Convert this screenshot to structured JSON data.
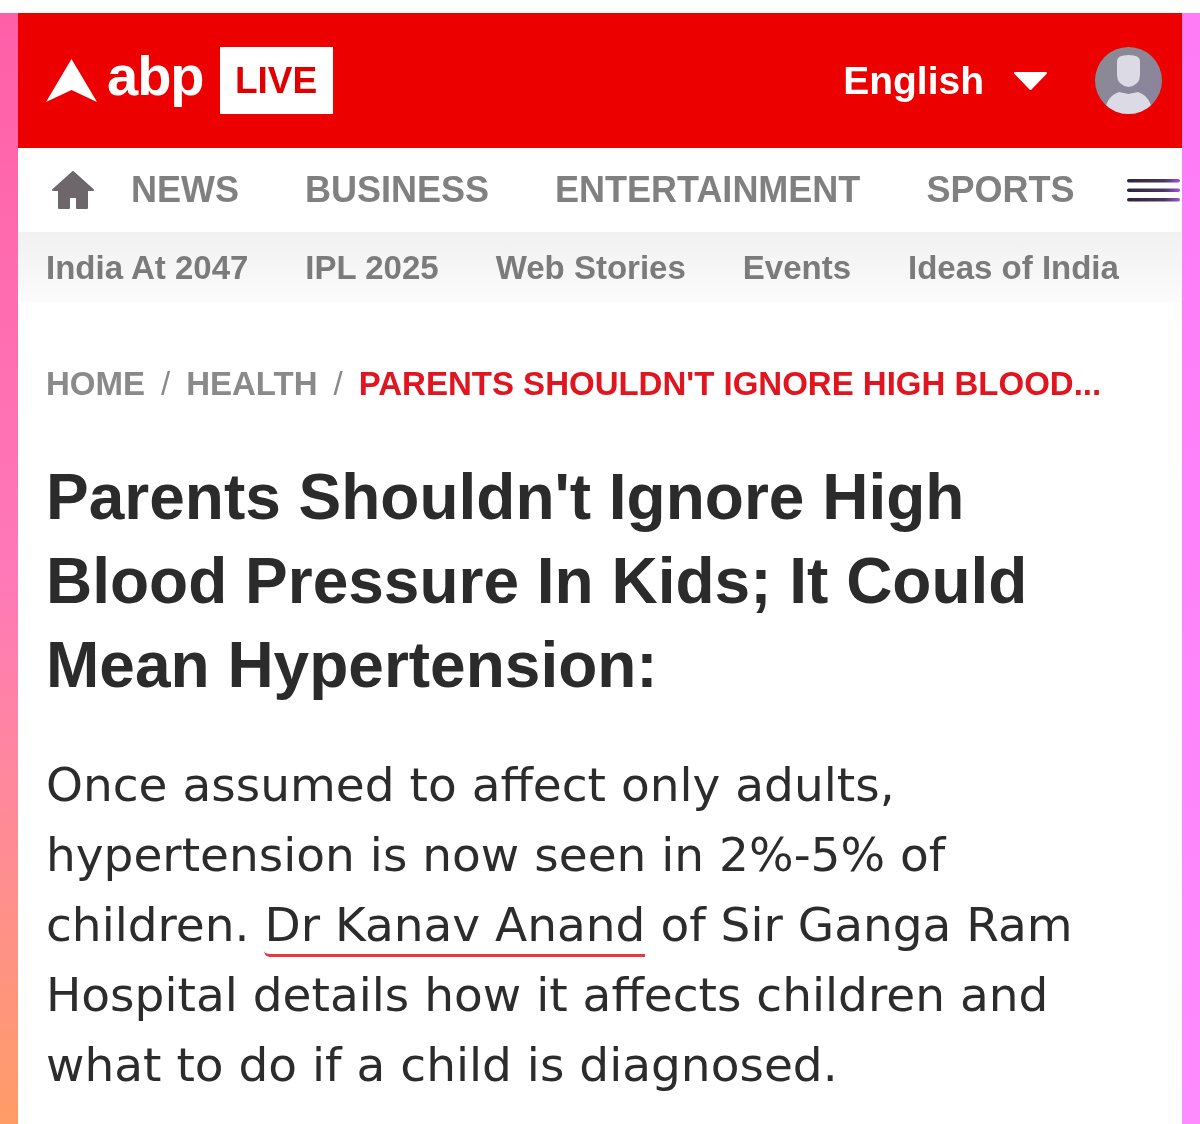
{
  "header": {
    "logo": {
      "wordmark": "abp",
      "badge": "LIVE"
    },
    "language": {
      "label": "English"
    }
  },
  "nav": {
    "items": [
      {
        "label": "NEWS"
      },
      {
        "label": "BUSINESS"
      },
      {
        "label": "ENTERTAINMENT"
      },
      {
        "label": "SPORTS"
      }
    ]
  },
  "sub_nav": {
    "items": [
      {
        "label": "India At 2047"
      },
      {
        "label": "IPL 2025"
      },
      {
        "label": "Web Stories"
      },
      {
        "label": "Events"
      },
      {
        "label": "Ideas of India"
      }
    ]
  },
  "breadcrumb": [
    {
      "kind": "link",
      "label": "HOME"
    },
    {
      "kind": "separator",
      "label": "/"
    },
    {
      "kind": "link",
      "label": "HEALTH"
    },
    {
      "kind": "separator",
      "label": "/"
    },
    {
      "kind": "current",
      "label": "PARENTS SHOULDN'T IGNORE HIGH BLOOD..."
    }
  ],
  "article": {
    "title": "Parents Shouldn't Ignore High Blood Pressure In Kids; It Could Mean Hypertension:",
    "summary": [
      {
        "text": "Once assumed to affect only adults, hypertension is now seen in 2%-5% of children. ",
        "underlined": false
      },
      {
        "text": "Dr Kanav Anand",
        "underlined": true
      },
      {
        "text": " of Sir Ganga Ram Hospital details how it affects children and what to do if a child is diagnosed.",
        "underlined": false
      }
    ]
  }
}
